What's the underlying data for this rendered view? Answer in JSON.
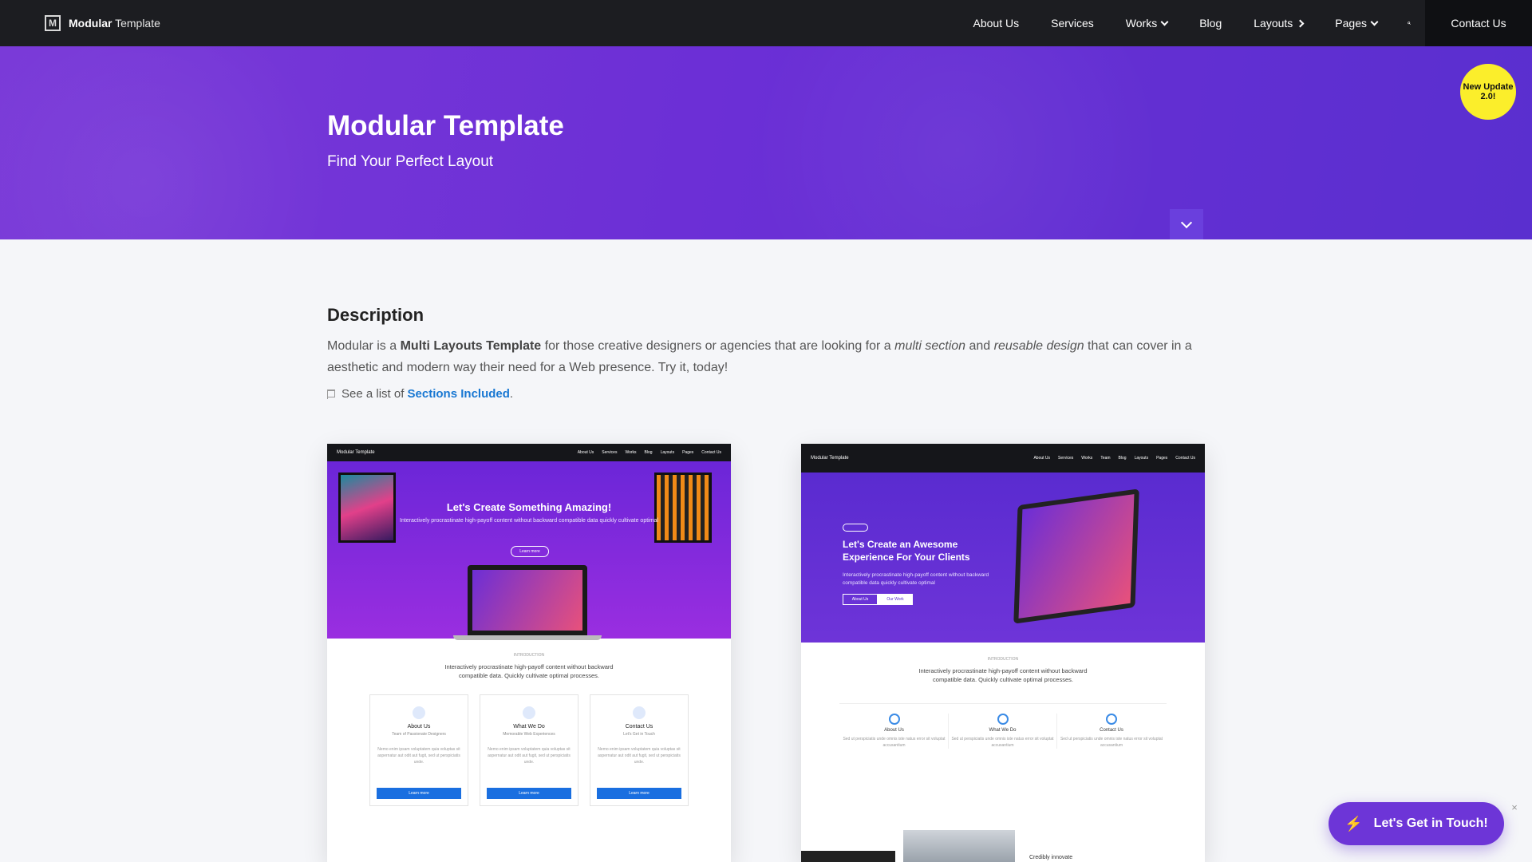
{
  "nav": {
    "brand_bold": "Modular",
    "brand_rest": " Template",
    "logo_letter": "M",
    "items": [
      {
        "label": "About Us"
      },
      {
        "label": "Services"
      },
      {
        "label": "Works"
      },
      {
        "label": "Blog"
      },
      {
        "label": "Layouts"
      },
      {
        "label": "Pages"
      }
    ],
    "contact": "Contact Us"
  },
  "hero": {
    "title": "Modular Template",
    "subtitle": "Find Your Perfect Layout",
    "badge": "New Update 2.0!"
  },
  "description": {
    "title": "Description",
    "text_1": "Modular is a ",
    "bold_1": "Multi Layouts Template",
    "text_2": " for those creative designers or agencies that are looking for a ",
    "ital_1": "multi section",
    "text_3": " and ",
    "ital_2": "reusable design",
    "text_4": " that can cover in a aesthetic and modern way their need for a Web presence. Try it, today!",
    "list_prefix": "See a list of ",
    "list_link": "Sections Included",
    "list_suffix": "."
  },
  "preview1": {
    "brand": "Modular Template",
    "menu": [
      "About Us",
      "Services",
      "Works",
      "Blog",
      "Layouts",
      "Pages",
      "Contact Us"
    ],
    "heading": "Let's Create Something Amazing!",
    "text": "Interactively procrastinate high-payoff content without backward compatible data quickly cultivate optimal",
    "button": "Learn more",
    "section_tag": "INTRODUCTION",
    "intro": "Interactively procrastinate high-payoff content without backward compatible data. Quickly cultivate optimal processes.",
    "cards": [
      {
        "title": "About Us",
        "subtitle": "Team of Passionate Designers",
        "body": "Nemo enim ipsam voluptatem quia voluptas sit aspernatur aut odit aut fugit, sed ut perspiciatis unde.",
        "button": "Learn more"
      },
      {
        "title": "What We Do",
        "subtitle": "Memorable Web Experiences",
        "body": "Nemo enim ipsam voluptatem quia voluptas sit aspernatur aut odit aut fugit, sed ut perspiciatis unde.",
        "button": "Learn more"
      },
      {
        "title": "Contact Us",
        "subtitle": "Let's Get in Touch",
        "body": "Nemo enim ipsam voluptatem quia voluptas sit aspernatur aut odit aut fugit, sed ut perspiciatis unde.",
        "button": "Learn more"
      }
    ]
  },
  "preview2": {
    "brand": "Modular Template",
    "menu": [
      "About Us",
      "Services",
      "Works",
      "Team",
      "Blog",
      "Layouts",
      "Pages",
      "Contact Us"
    ],
    "heading": "Let's Create an Awesome Experience For Your Clients",
    "text": "Interactively procrastinate high-payoff content without backward compatible data quickly cultivate optimal",
    "btn_1": "About Us",
    "btn_2": "Our Work",
    "section_tag": "INTRODUCTION",
    "intro": "Interactively procrastinate high-payoff content without backward compatible data. Quickly cultivate optimal processes.",
    "cols": [
      {
        "title": "About Us",
        "body": "Sed ut perspiciatis unde omnis iste natus error sit voluptat accusantium"
      },
      {
        "title": "What We Do",
        "body": "Sed ut perspiciatis unde omnis iste natus error sit voluptat accusantium"
      },
      {
        "title": "Contact Us",
        "body": "Sed ut perspiciatis unde omnis iste natus error sit voluptat accusantium"
      }
    ],
    "credit": "Credibly innovate"
  },
  "cta": {
    "label": "Let's Get in Touch!",
    "close": "×"
  },
  "colors": {
    "accent": "#6d35d7",
    "hero": "#6c2fd6",
    "badge": "#fbee2b",
    "link": "#1877d2"
  }
}
